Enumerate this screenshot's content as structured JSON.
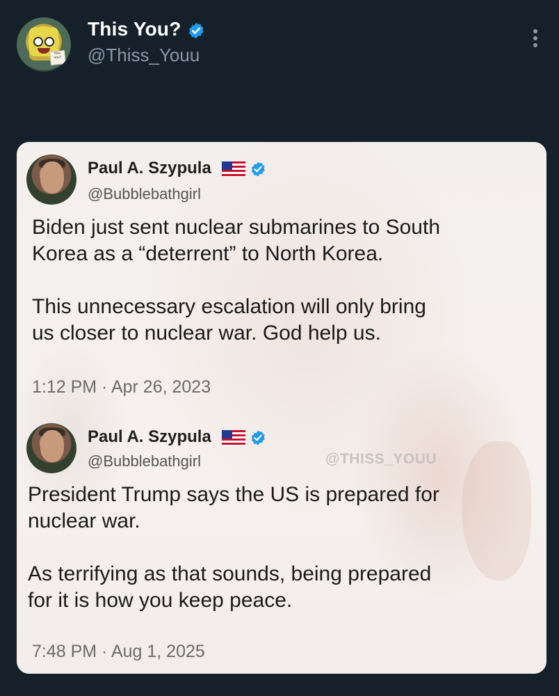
{
  "header": {
    "display_name": "This You?",
    "handle": "@Thiss_Youu",
    "avatar_sign_text": "This You?",
    "icons": {
      "verified": "verified-badge-icon",
      "more": "more-vertical-icon"
    }
  },
  "card": {
    "watermark": "@THISS_YOUU",
    "tweets": [
      {
        "name": "Paul A. Szypula",
        "handle": "@Bubblebathgirl",
        "text": "Biden just sent nuclear submarines to South\nKorea as a “deterrent” to North Korea.\n\nThis unnecessary escalation will only bring\nus closer to nuclear war. God help us.",
        "time": "1:12 PM · Apr 26, 2023"
      },
      {
        "name": "Paul A. Szypula",
        "handle": "@Bubblebathgirl",
        "text": "President Trump says the US is prepared for\nnuclear war.\n\nAs terrifying as that sounds, being prepared\nfor it is how you keep peace.",
        "time": "7:48 PM · Aug 1, 2025"
      }
    ]
  },
  "colors": {
    "background": "#15202b",
    "verified": "#1d9bf0",
    "card": "#f5f1ef"
  }
}
